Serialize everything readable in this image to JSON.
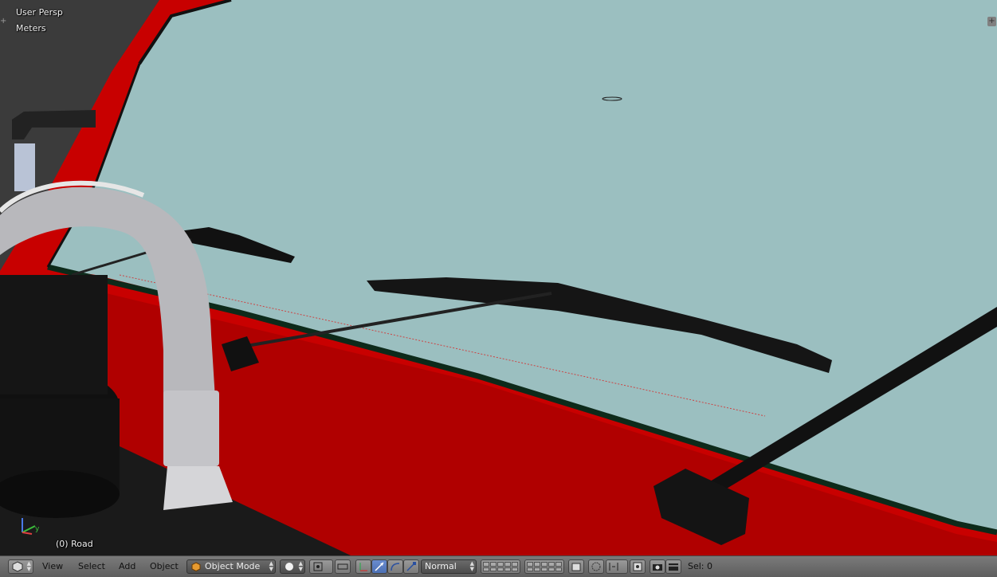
{
  "viewport": {
    "view_name": "User Persp",
    "units": "Meters",
    "active_object": "(0) Road"
  },
  "header": {
    "menus": [
      "View",
      "Select",
      "Add",
      "Object"
    ],
    "mode": "Object Mode",
    "transform_orientation": "Normal",
    "selection_info": "Sel: 0"
  },
  "icons": {
    "editor_type": "3d-view-icon",
    "mode": "cube-icon",
    "shading": "solid-sphere-icon",
    "pivot": "pivot-icon",
    "manipulator": [
      "translate-icon",
      "rotate-icon",
      "scale-icon"
    ],
    "layers": "layer-grid-icon",
    "render": [
      "render-still-icon",
      "render-anim-icon"
    ]
  },
  "colors": {
    "windshield": "#9bbfc0",
    "car_body": "#c80000",
    "header_bg": "#6e6e6e",
    "active_button": "#5a7ec4"
  }
}
